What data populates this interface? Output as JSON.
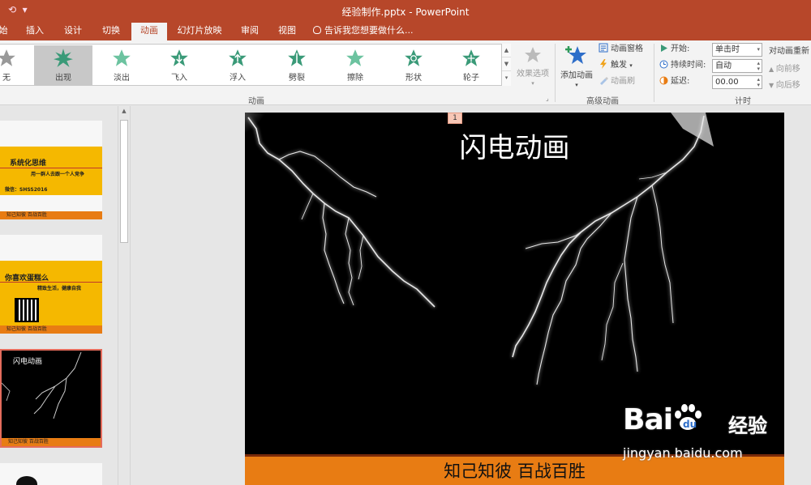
{
  "window": {
    "title": "经验制作.pptx - PowerPoint",
    "qa_icons": [
      "undo-icon",
      "customize-quick-access-icon"
    ]
  },
  "tabs": [
    {
      "label": "始"
    },
    {
      "label": "插入"
    },
    {
      "label": "设计"
    },
    {
      "label": "切换"
    },
    {
      "label": "动画",
      "active": true
    },
    {
      "label": "幻灯片放映"
    },
    {
      "label": "审阅"
    },
    {
      "label": "视图"
    },
    {
      "label": "告诉我您想要做什么..."
    }
  ],
  "gallery": {
    "items": [
      {
        "label": "无",
        "color": "#999999"
      },
      {
        "label": "出现",
        "color": "#3a9a78",
        "selected": true
      },
      {
        "label": "淡出",
        "color": "#4caf8a"
      },
      {
        "label": "飞入",
        "color": "#3a9a78"
      },
      {
        "label": "浮入",
        "color": "#3a9a78"
      },
      {
        "label": "劈裂",
        "color": "#3a9a78"
      },
      {
        "label": "擦除",
        "color": "#4caf8a"
      },
      {
        "label": "形状",
        "color": "#3a9a78"
      },
      {
        "label": "轮子",
        "color": "#3a9a78"
      }
    ],
    "group_label": "动画"
  },
  "effects_options": {
    "label": "效果选项"
  },
  "advanced": {
    "add_animation": "添加动画",
    "animation_pane": "动画窗格",
    "trigger": "触发",
    "painter": "动画刷",
    "group_label": "高级动画"
  },
  "timing": {
    "start_label": "开始:",
    "start_value": "单击时",
    "duration_label": "持续时间:",
    "duration_value": "自动",
    "delay_label": "延迟:",
    "delay_value": "00.00",
    "reorder_title": "对动画重新",
    "move_earlier": "向前移",
    "move_later": "向后移",
    "group_label": "计时"
  },
  "thumbnails": [
    {
      "title": "系统化思维",
      "subtitle": "用一群人去跟一个人竞争",
      "wechat": "微信：SHSS2016",
      "footer": "知己知彼 百战百胜"
    },
    {
      "title": "你喜欢蛋糕么",
      "subtitle": "精致生活，健康自我",
      "footer": "知己知彼 百战百胜"
    },
    {
      "title": "闪电动画",
      "footer": "知己知彼 百战百胜"
    }
  ],
  "slide": {
    "seq_badge": "1",
    "title": "闪电动画",
    "footer": "知己知彼 百战百胜"
  },
  "watermark": {
    "brand": "Bai",
    "brand_suffix": "经验",
    "url": "jingyan.baidu.com"
  },
  "colors": {
    "accent": "#b7472a",
    "slide_footer": "#e87c13",
    "thumb_band": "#f5b800"
  }
}
